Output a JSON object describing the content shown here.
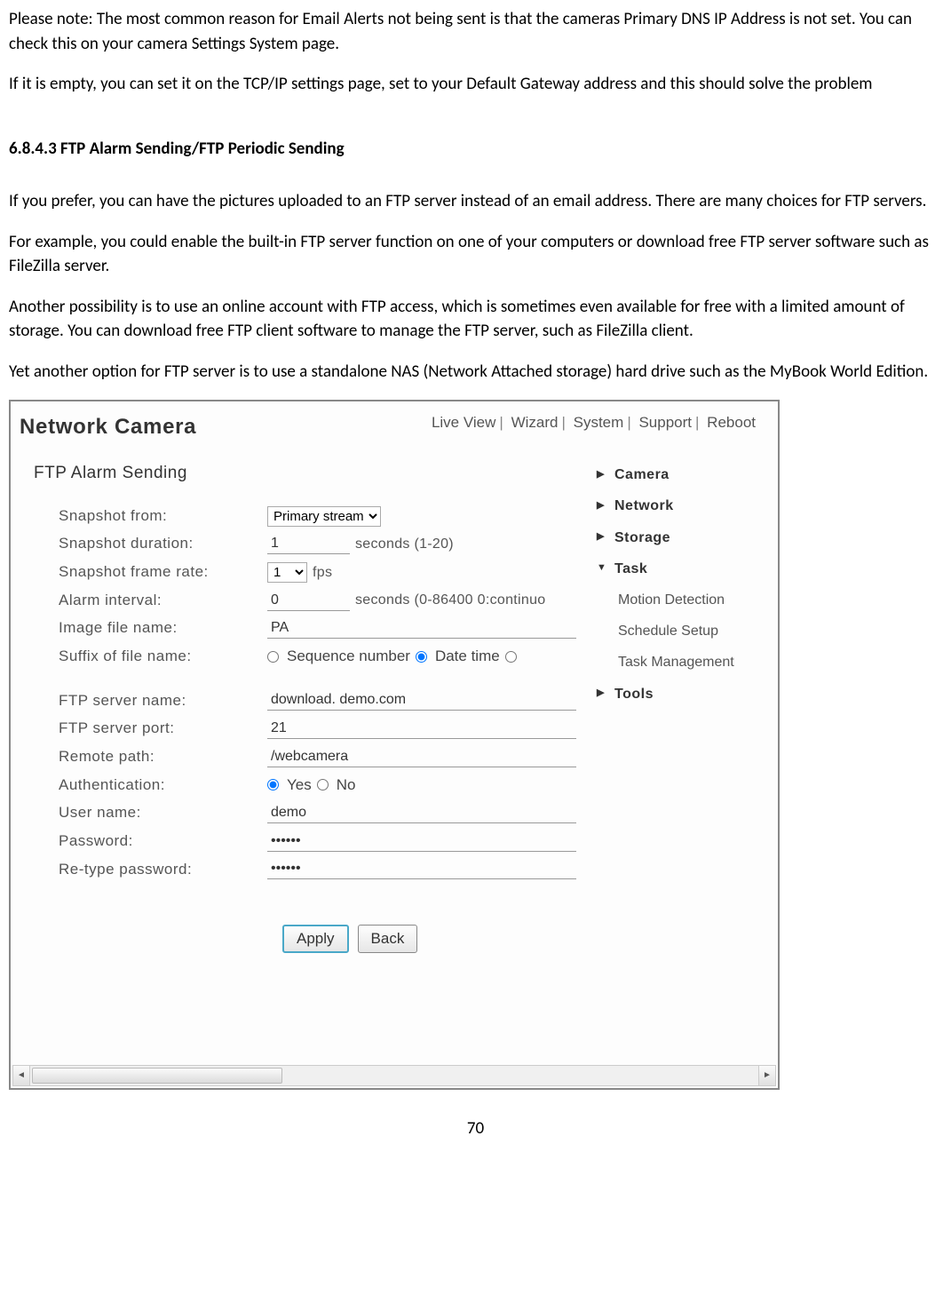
{
  "doc": {
    "p1": "Please note: The most common reason for Email Alerts not being sent is that the cameras Primary DNS IP Address is not set. You can check this on your camera Settings System page.",
    "p2": "If it is empty, you can set it on the TCP/IP settings page, set to your Default Gateway address and this should solve the problem",
    "heading": "6.8.4.3 FTP Alarm Sending/FTP Periodic Sending",
    "p3": "If you prefer, you can have the pictures uploaded to an FTP server instead of an email address. There are many choices for FTP servers.",
    "p4": "For example, you could enable the built-in FTP server function on one of your computers or download free FTP server software such as FileZilla server.",
    "p5": "Another possibility is to use an online account with FTP access, which is sometimes even available for free with a limited amount of storage. You can download free FTP client software to manage the FTP server, such as FileZilla client.",
    "p6": "Yet another option for FTP server is to use a standalone NAS (Network Attached storage) hard drive such as the MyBook World Edition.",
    "page_number": "70"
  },
  "app": {
    "title": "Network Camera",
    "top_nav": [
      "Live View",
      "Wizard",
      "System",
      "Support",
      "Reboot"
    ],
    "panel_title": "FTP Alarm Sending",
    "labels": {
      "snapshot_from": "Snapshot from:",
      "snapshot_duration": "Snapshot duration:",
      "snapshot_frame_rate": "Snapshot frame rate:",
      "alarm_interval": "Alarm interval:",
      "image_file_name": "Image file name:",
      "suffix": "Suffix of file name:",
      "ftp_server_name": "FTP server name:",
      "ftp_server_port": "FTP server port:",
      "remote_path": "Remote path:",
      "authentication": "Authentication:",
      "user_name": "User name:",
      "password": "Password:",
      "retype_password": "Re-type password:"
    },
    "values": {
      "snapshot_from_selected": "Primary stream",
      "snapshot_duration": "1",
      "snapshot_duration_hint": "seconds (1-20)",
      "snapshot_frame_rate": "1",
      "snapshot_frame_rate_unit": "fps",
      "alarm_interval": "0",
      "alarm_interval_hint": "seconds (0-86400 0:continuo",
      "image_file_name": "PA",
      "suffix_opt1": "Sequence number",
      "suffix_opt2": "Date time",
      "ftp_server_name": "download. demo.com",
      "ftp_server_port": "21",
      "remote_path": "/webcamera",
      "auth_yes": "Yes",
      "auth_no": "No",
      "user_name": "demo",
      "password": "••••••",
      "retype_password": "••••••"
    },
    "buttons": {
      "apply": "Apply",
      "back": "Back"
    },
    "side_nav": {
      "camera": "Camera",
      "network": "Network",
      "storage": "Storage",
      "task": "Task",
      "task_items": [
        "Motion Detection",
        "Schedule Setup",
        "Task Management"
      ],
      "tools": "Tools"
    }
  }
}
